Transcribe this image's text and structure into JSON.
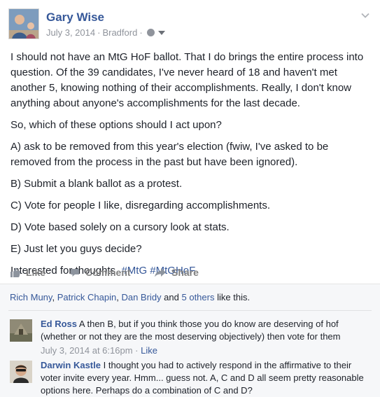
{
  "post": {
    "author": "Gary Wise",
    "date": "July 3, 2014",
    "location": "Bradford",
    "paragraphs": [
      "I should not have an MtG HoF ballot. That I do brings the entire process into question. Of the 39 candidates, I've never heard of 18 and haven't met another 5, knowing nothing of their accomplishments. Really, I don't know anything about anyone's accomplishments for the last decade.",
      "So, which of these options should I act upon?",
      "A) ask to be removed from this year's election (fwiw, I've asked to be removed from the process in the past but have been ignored).",
      "B) Submit a blank ballot as a protest.",
      "C) Vote for people I like, disregarding accomplishments.",
      "D) Vote based solely on a cursory look at stats.",
      "E) Just let you guys decide?"
    ],
    "closing_text": "Interested for thoughts.",
    "hashtags": [
      "#MtG",
      "#MtGHoF"
    ]
  },
  "actions": {
    "like": "Like",
    "comment": "Comment",
    "share": "Share"
  },
  "likes_summary": {
    "names": [
      "Rich Muny",
      "Patrick Chapin",
      "Dan Bridy"
    ],
    "and": "and",
    "others": "5 others",
    "suffix": "like this."
  },
  "comments": [
    {
      "name": "Ed Ross",
      "text": "A then B, but if you think those you do know are deserving of hof (whether or not they are the most deserving objectively) then vote for them",
      "time": "July 3, 2014 at 6:16pm",
      "like_label": "Like"
    },
    {
      "name": "Darwin Kastle",
      "text": "I thought you had to actively respond in the affirmative to their voter invite every year. Hmm... guess not. A, C and D all seem pretty reasonable options here. Perhaps do a combination of C and D?"
    }
  ],
  "icons": {
    "options": "chevron-down-icon",
    "privacy": "globe-icon",
    "like": "thumbs-up-icon",
    "comment": "speech-bubble-icon",
    "share": "share-arrow-icon"
  },
  "colors": {
    "link": "#365899",
    "meta": "#90949c",
    "text": "#1d2129",
    "action": "#7f7f7f",
    "summary_bg": "#f6f7f9"
  }
}
